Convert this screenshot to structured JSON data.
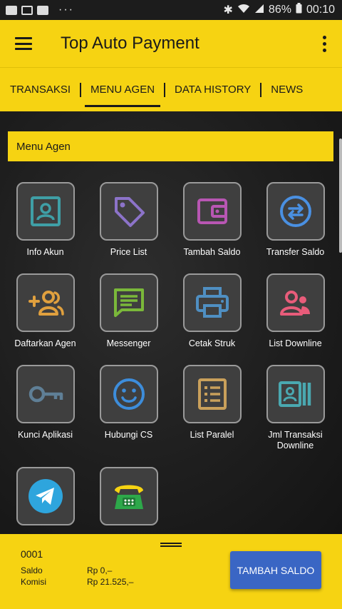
{
  "status_bar": {
    "more_indicator": "···",
    "battery": "86%",
    "time": "00:10"
  },
  "app_bar": {
    "title": "Top Auto Payment"
  },
  "tabs": [
    {
      "label": "TRANSAKSI",
      "active": false
    },
    {
      "label": "MENU AGEN",
      "active": true
    },
    {
      "label": "DATA HISTORY",
      "active": false
    },
    {
      "label": "NEWS",
      "active": false
    }
  ],
  "section": {
    "title": "Menu Agen"
  },
  "menu": [
    {
      "label": "Info Akun",
      "icon": "account-box-icon",
      "color": "#3f9fa6"
    },
    {
      "label": "Price List",
      "icon": "price-tag-icon",
      "color": "#8c73c9"
    },
    {
      "label": "Tambah Saldo",
      "icon": "wallet-icon",
      "color": "#b856b3"
    },
    {
      "label": "Transfer Saldo",
      "icon": "transfer-icon",
      "color": "#4a90e2"
    },
    {
      "label": "Daftarkan Agen",
      "icon": "add-user-icon",
      "color": "#e0a03e"
    },
    {
      "label": "Messenger",
      "icon": "message-icon",
      "color": "#7ab83a"
    },
    {
      "label": "Cetak Struk",
      "icon": "printer-icon",
      "color": "#4f8fc2"
    },
    {
      "label": "List Downline",
      "icon": "group-icon",
      "color": "#e85c7a"
    },
    {
      "label": "Kunci Aplikasi",
      "icon": "key-icon",
      "color": "#5f7f96"
    },
    {
      "label": "Hubungi CS",
      "icon": "smiley-icon",
      "color": "#3d8ddb"
    },
    {
      "label": "List Paralel",
      "icon": "list-icon",
      "color": "#c9a05b"
    },
    {
      "label": "Jml Transaksi Downline",
      "icon": "contacts-icon",
      "color": "#4aa8b0"
    },
    {
      "label": "",
      "icon": "telegram-icon",
      "color": "#2ea5dd"
    },
    {
      "label": "",
      "icon": "phone-icon",
      "color": "#2da84a"
    }
  ],
  "bottom": {
    "account_id": "0001",
    "saldo_label": "Saldo",
    "saldo_value": "Rp 0,–",
    "komisi_label": "Komisi",
    "komisi_value": "Rp 21.525,–",
    "button_label": "TAMBAH SALDO",
    "button_color": "#3a66c4"
  },
  "colors": {
    "accent": "#f6d312",
    "background": "#1e1e1e"
  }
}
